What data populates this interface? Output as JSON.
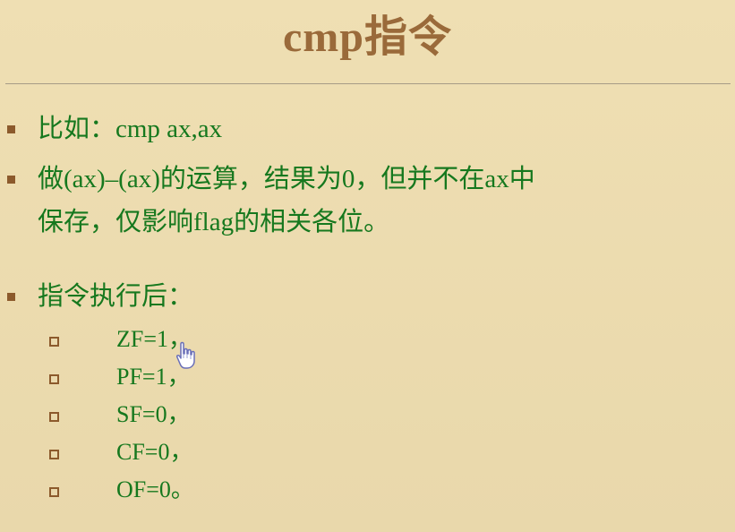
{
  "slide": {
    "title": "cmp指令",
    "bullets": [
      {
        "text": "比如：cmp ax,ax"
      },
      {
        "text": "做(ax)–(ax)的运算，结果为0，但并不在ax中"
      },
      {
        "text": "保存，仅影响flag的相关各位。"
      },
      {
        "text": "指令执行后："
      }
    ],
    "sub_items": [
      {
        "text": "ZF=1，"
      },
      {
        "text": "PF=1，"
      },
      {
        "text": "SF=0，"
      },
      {
        "text": "CF=0，"
      },
      {
        "text": "OF=0。"
      }
    ]
  },
  "colors": {
    "background": "#ecdcb0",
    "title": "#9a6a3a",
    "text": "#16781e",
    "bullet": "#8c5a2c"
  },
  "icons": {
    "cursor": "hand-pointer-icon"
  }
}
